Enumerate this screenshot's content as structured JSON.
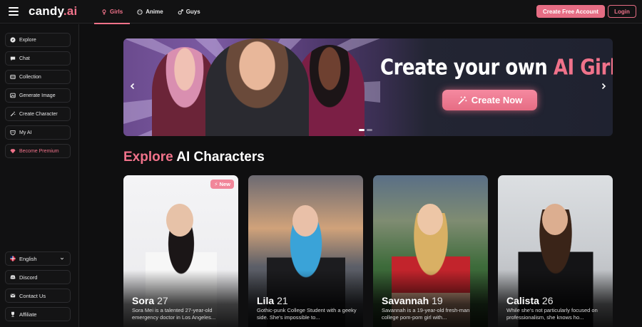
{
  "brand": {
    "name_main": "candy",
    "name_accent": ".ai"
  },
  "nav": {
    "tabs": [
      {
        "label": "Girls",
        "icon": "female-icon",
        "active": true
      },
      {
        "label": "Anime",
        "icon": "anime-icon",
        "active": false
      },
      {
        "label": "Guys",
        "icon": "male-icon",
        "active": false
      }
    ],
    "create_account": "Create Free Account",
    "login": "Login"
  },
  "sidebar": {
    "items": [
      {
        "label": "Explore",
        "icon": "compass-icon"
      },
      {
        "label": "Chat",
        "icon": "chat-icon"
      },
      {
        "label": "Collection",
        "icon": "collection-icon"
      },
      {
        "label": "Generate Image",
        "icon": "image-icon"
      },
      {
        "label": "Create Character",
        "icon": "wand-icon"
      },
      {
        "label": "My AI",
        "icon": "mask-icon"
      },
      {
        "label": "Become Premium",
        "icon": "diamond-icon"
      }
    ],
    "bottom": [
      {
        "label": "English",
        "icon": "flag-icon"
      },
      {
        "label": "Discord",
        "icon": "discord-icon"
      },
      {
        "label": "Contact Us",
        "icon": "contact-icon"
      },
      {
        "label": "Affiliate",
        "icon": "trophy-icon"
      }
    ]
  },
  "hero": {
    "title_main": "Create your own ",
    "title_accent": "AI Girlfriend",
    "cta": "Create Now"
  },
  "section": {
    "title_accent": "Explore",
    "title_main": " AI Characters"
  },
  "badge_new": "New",
  "cards": [
    {
      "name": "Sora",
      "age": "27",
      "desc": "Sora Mei is a talented 27-year-old emergency doctor in Los Angeles..."
    },
    {
      "name": "Lila",
      "age": "21",
      "desc": "Gothic-punk College Student with a geeky side. She's impossible to..."
    },
    {
      "name": "Savannah",
      "age": "19",
      "desc": "Savannah is a 19-year-old fresh-man college pom-pom girl with..."
    },
    {
      "name": "Calista",
      "age": "26",
      "desc": "While she's not particularly focused on professionalism, she knows ho..."
    }
  ],
  "colors": {
    "accent": "#f0728a",
    "button": "#e66d84",
    "background": "#0f0f10"
  }
}
